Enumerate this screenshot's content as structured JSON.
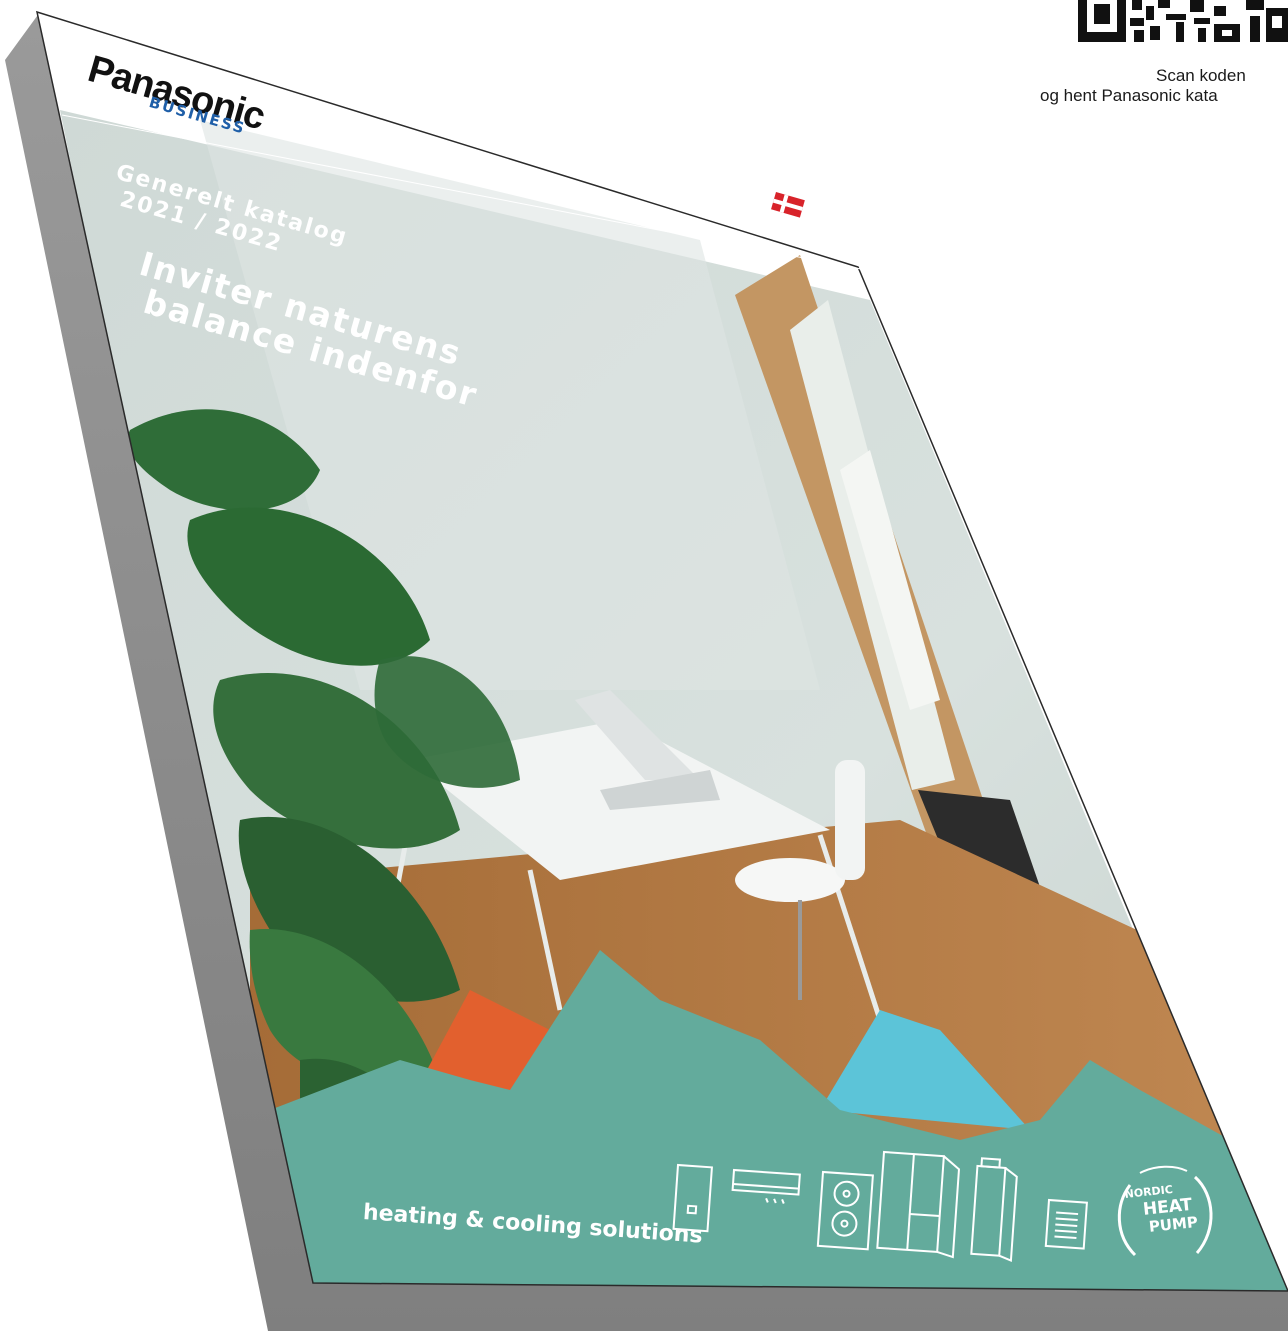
{
  "qr": {
    "caption_line1": "Scan koden",
    "caption_line2": "og hent Panasonic kata"
  },
  "brand": {
    "name": "Panasonic",
    "division": "BUSINESS"
  },
  "cover": {
    "catalog_title": "Generelt katalog",
    "catalog_year": "2021 / 2022",
    "headline_line1": "Inviter naturens",
    "headline_line2": "balance indenfor",
    "tagline": "heating & cooling solutions",
    "flag": "danish-flag"
  },
  "partner_logo": {
    "line1": "NORDIC",
    "line2": "HEAT",
    "line3": "PUMP"
  },
  "product_icons": [
    "wall-controller-icon",
    "split-indoor-unit-icon",
    "outdoor-unit-icon",
    "indoor-cabinet-icon",
    "water-tank-icon",
    "small-heater-icon"
  ],
  "colors": {
    "teal": "#63ab9c",
    "orange": "#e2602e",
    "sky_blue": "#5cc4d8",
    "wall": "#d4dedb",
    "floor": "#b0773f",
    "shadow": "#8e8e8e"
  }
}
